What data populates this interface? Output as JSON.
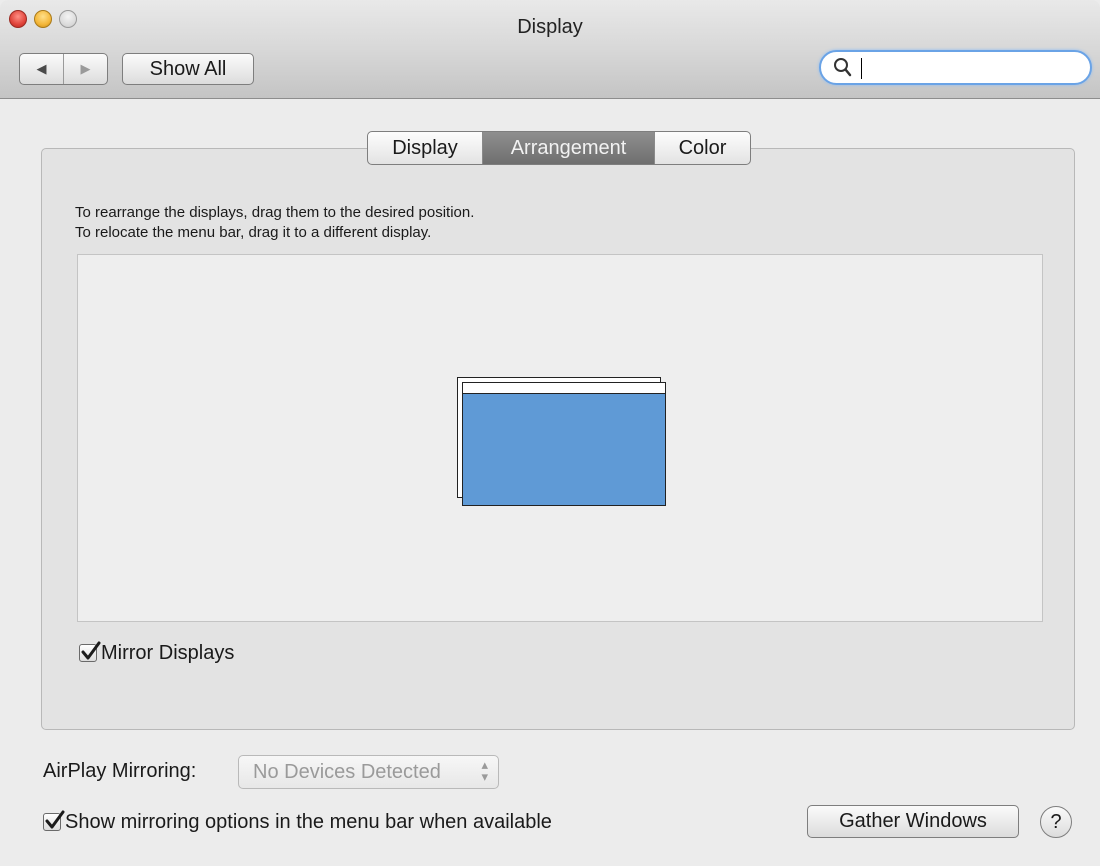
{
  "window": {
    "title": "Display"
  },
  "toolbar": {
    "back_glyph": "◀",
    "forward_glyph": "▶",
    "show_all_label": "Show All",
    "search_value": "",
    "search_placeholder": ""
  },
  "tabs": [
    {
      "label": "Display",
      "selected": false
    },
    {
      "label": "Arrangement",
      "selected": true
    },
    {
      "label": "Color",
      "selected": false
    }
  ],
  "arrangement": {
    "instruction_line1": "To rearrange the displays, drag them to the desired position.",
    "instruction_line2": "To relocate the menu bar, drag it to a different display.",
    "display_color": "#5f9ad6",
    "mirror_displays_label": "Mirror Displays",
    "mirror_displays_checked": true
  },
  "airplay": {
    "label": "AirPlay Mirroring:",
    "selected_value": "No Devices Detected",
    "enabled": false
  },
  "footer": {
    "show_mirroring_label": "Show mirroring options in the menu bar when available",
    "show_mirroring_checked": true,
    "gather_windows_label": "Gather Windows",
    "help_glyph": "?"
  },
  "colors": {
    "accent": "#6aa3e6",
    "selected_tab": "#7d7d7d",
    "close": "#e0443b",
    "minimize": "#f4b73a",
    "zoom": "#d8d8d8"
  }
}
